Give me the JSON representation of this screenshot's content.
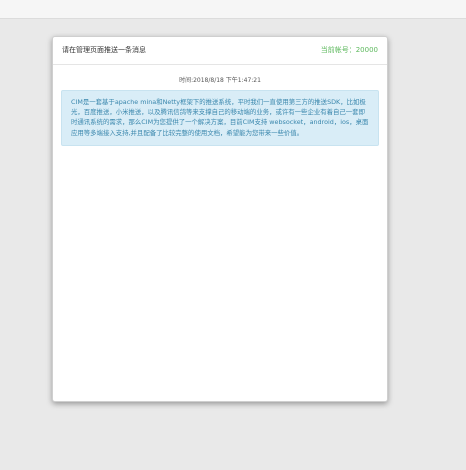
{
  "header": {
    "title": "请在管理页面推送一条消息",
    "account_label": "当前帐号：",
    "account_value": "20000"
  },
  "message": {
    "time_label": "时间:",
    "time_value": "2018/8/18 下午1:47:21",
    "body": "CIM是一套基于apache mina和Netty框架下的推送系统，平时我们一直使用第三方的推送SDK，比如极光，百度推送，小米推送，以及腾讯信鸽等来支撑自己的移动端的业务，或许有一些企业有着自己一套即时通讯系统的需求，那么CIM为您提供了一个解决方案，目前CIM支持 websocket，android，ios，桌面应用等多端接入支持,并且配备了比较完整的使用文档，希望能为您带来一些价值。"
  },
  "colors": {
    "background": "#e9e9e9",
    "panel": "#ffffff",
    "account_green": "#5cb85c",
    "bubble_background": "#d9edf7",
    "bubble_text": "#3a87ad"
  }
}
